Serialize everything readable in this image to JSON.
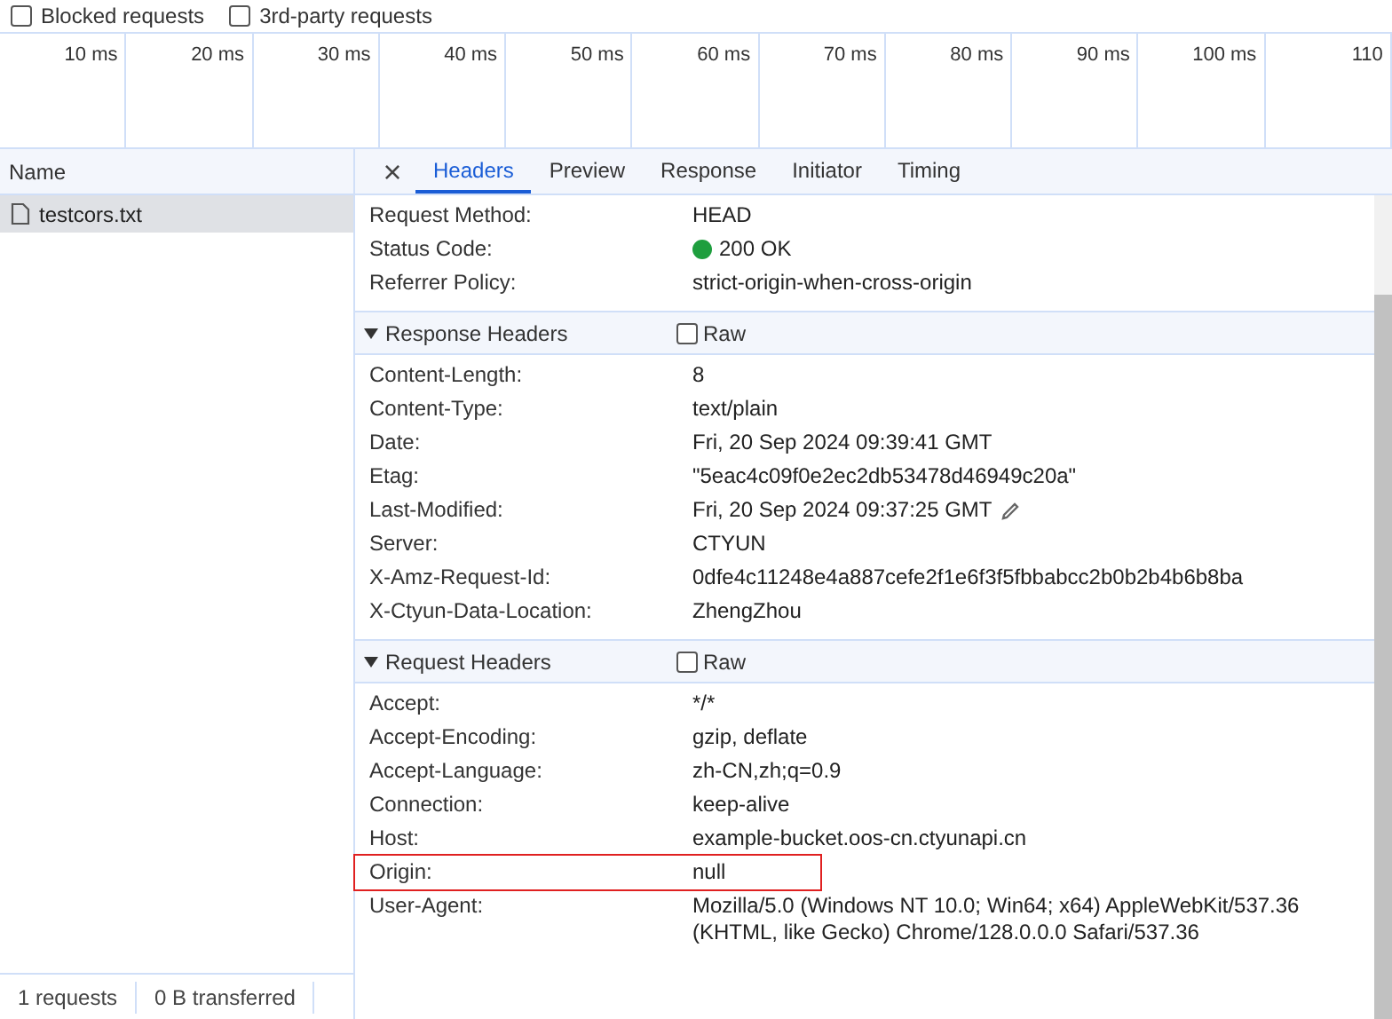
{
  "filters": [
    {
      "label": "Blocked requests",
      "checked": false
    },
    {
      "label": "3rd-party requests",
      "checked": false
    }
  ],
  "timeline": {
    "ticks": [
      "10 ms",
      "20 ms",
      "30 ms",
      "40 ms",
      "50 ms",
      "60 ms",
      "70 ms",
      "80 ms",
      "90 ms",
      "100 ms",
      "110"
    ]
  },
  "requests": {
    "column": "Name",
    "rows": [
      {
        "name": "testcors.txt",
        "selected": true
      }
    ]
  },
  "status_bar": [
    "1 requests",
    "0 B transferred"
  ],
  "detail": {
    "close": "×",
    "tabs": [
      {
        "label": "Headers",
        "selected": true
      },
      {
        "label": "Preview",
        "selected": false
      },
      {
        "label": "Response",
        "selected": false
      },
      {
        "label": "Initiator",
        "selected": false
      },
      {
        "label": "Timing",
        "selected": false
      }
    ],
    "general": [
      {
        "name": "Request Method:",
        "value": "HEAD"
      },
      {
        "name": "Status Code:",
        "value": "200 OK",
        "color": "#1e9e3e"
      },
      {
        "name": "Referrer Policy:",
        "value": "strict-origin-when-cross-origin"
      }
    ],
    "sections": [
      {
        "title": "Response Headers",
        "expanded": true,
        "raw_label": "Raw",
        "raw": false,
        "headers": [
          {
            "name": "Content-Length:",
            "value": "8"
          },
          {
            "name": "Content-Type:",
            "value": "text/plain"
          },
          {
            "name": "Date:",
            "value": "Fri, 20 Sep 2024 09:39:41 GMT"
          },
          {
            "name": "Etag:",
            "value": "\"5eac4c09f0e2ec2db53478d46949c20a\""
          },
          {
            "name": "Last-Modified:",
            "value": "Fri, 20 Sep 2024 09:37:25 GMT",
            "editable": true
          },
          {
            "name": "Server:",
            "value": "CTYUN"
          },
          {
            "name": "X-Amz-Request-Id:",
            "value": "0dfe4c11248e4a887cefe2f1e6f3f5fbbabcc2b0b2b4b6b8ba"
          },
          {
            "name": "X-Ctyun-Data-Location:",
            "value": "ZhengZhou"
          }
        ]
      },
      {
        "title": "Request Headers",
        "expanded": true,
        "raw_label": "Raw",
        "raw": false,
        "headers": [
          {
            "name": "Accept:",
            "value": "*/*"
          },
          {
            "name": "Accept-Encoding:",
            "value": "gzip, deflate"
          },
          {
            "name": "Accept-Language:",
            "value": "zh-CN,zh;q=0.9"
          },
          {
            "name": "Connection:",
            "value": "keep-alive"
          },
          {
            "name": "Host:",
            "value": "example-bucket.oos-cn.ctyunapi.cn"
          },
          {
            "name": "Origin:",
            "value": "null",
            "highlighted": true
          },
          {
            "name": "User-Agent:",
            "value": "Mozilla/5.0 (Windows NT 10.0; Win64; x64) AppleWebKit/537.36 (KHTML, like Gecko) Chrome/128.0.0.0 Safari/537.36"
          }
        ]
      }
    ]
  }
}
